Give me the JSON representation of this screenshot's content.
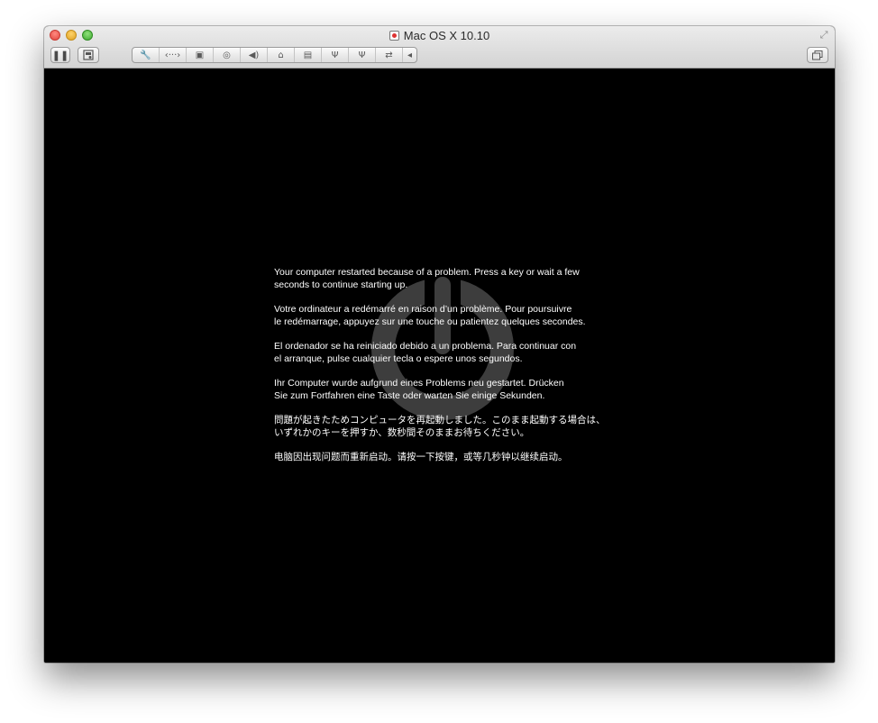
{
  "window": {
    "title": "Mac OS X 10.10"
  },
  "toolbar": {
    "pause_icon": "pause-icon",
    "snapshot_icon": "snapshot-icon",
    "device_icons": [
      "wrench-icon",
      "network-icon",
      "harddisk-icon",
      "cd-icon",
      "sound-icon",
      "usb-icon",
      "printer-icon",
      "usb-icon",
      "usb-icon",
      "sync-icon",
      "chevron-left-icon"
    ],
    "window_mode_icon": "window-mode-icon"
  },
  "screen": {
    "background_color": "#000000",
    "messages": [
      [
        "Your computer restarted because of a problem. Press a key or wait a few",
        "seconds to continue starting up."
      ],
      [
        "Votre ordinateur a redémarré en raison d’un problème. Pour poursuivre",
        "le redémarrage, appuyez sur une touche ou patientez quelques secondes."
      ],
      [
        "El ordenador se ha reiniciado debido a un problema. Para continuar con",
        "el arranque, pulse cualquier tecla o espere unos segundos."
      ],
      [
        "Ihr Computer wurde aufgrund eines Problems neu gestartet. Drücken",
        "Sie zum Fortfahren eine Taste oder warten Sie einige Sekunden."
      ],
      [
        "問題が起きたためコンピュータを再起動しました。このまま起動する場合は、",
        "いずれかのキーを押すか、数秒間そのままお待ちください。"
      ],
      [
        "电脑因出现问题而重新启动。请按一下按键，或等几秒钟以继续启动。"
      ]
    ]
  }
}
